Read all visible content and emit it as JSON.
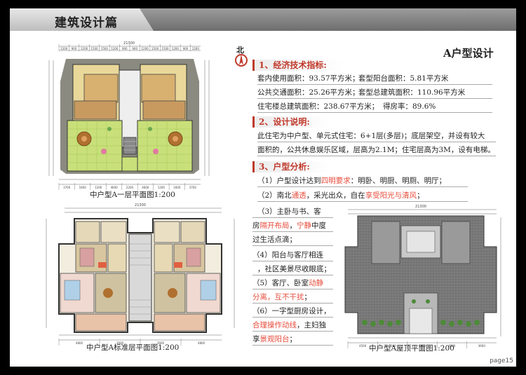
{
  "header": {
    "title": "建筑设计篇"
  },
  "right_title": "A户型设计",
  "compass_label": "北",
  "sections": [
    {
      "title": "1、经济技术指标:"
    },
    {
      "title": "2、设计说明:"
    },
    {
      "title": "3、户型分析:"
    }
  ],
  "tech": {
    "line1a": "套内使用面积：93.57平方米；",
    "line1b": "套型阳台面积：5.81平方米",
    "line2a": "公共交通面积：25.26平方米；",
    "line2b": "套型总建筑面积：110.96平方米",
    "line3a": "住宅楼总建筑面积：238.67平方米；",
    "line3b": "得房率：89.6%"
  },
  "design": {
    "line1": "此住宅为中户型、单元式住宅：6+1层(多层)；底层架空，并设有较大",
    "line2": "面积的，公共休息娱乐区域，层高为2.1M；住宅层高为3M，设有电梯。"
  },
  "analysis": {
    "p1_pre": "（1）户型设计达到",
    "p1_red": "四明要求",
    "p1_post": "：明卧、明厨、明厕、明厅；",
    "p2_pre": "（2）南北",
    "p2_red1": "通透",
    "p2_mid": "，采光出众，自在",
    "p2_red2": "享受阳光与清风",
    "p2_post": "；",
    "p3_a": "（3）主卧与书、客",
    "p3_b_pre": "房",
    "p3_b_red1": "隔开布局",
    "p3_b_mid": "，",
    "p3_b_red2": "宁静",
    "p3_b_post": "中度",
    "p3_c": "过生活点滴；",
    "p4_a": "（4）阳台与客厅相连",
    "p4_b": "，社区美景尽收眼底；",
    "p5_a_pre": "（5）客厅、卧室",
    "p5_a_red": "动静",
    "p5_b_red": "分离，互不干扰",
    "p5_b_post": "；",
    "p6_a": "（6）一字型厨房设计，",
    "p6_b_red": "合理操作动线",
    "p6_b_post": "，主妇独",
    "p6_c_pre": "享",
    "p6_c_red": "景观阳台",
    "p6_c_post": "；"
  },
  "plans": {
    "ground_caption": "中户型A一层平面图1:200",
    "standard_caption": "中户型A标准层平面图1:200",
    "roof_caption": "中户型A屋顶平面图1:200",
    "ground_dims_top": [
      "1200",
      "900",
      "1200",
      "1500",
      "1500",
      "1200",
      "900",
      "900",
      "1200",
      "1500",
      "1500",
      "1200",
      "900",
      "1200"
    ],
    "ground_total": "21300",
    "ground_dims_bottom": [
      "3700",
      "1600",
      "1200",
      "4600",
      "2200",
      "4600",
      "1200",
      "1600",
      "3700"
    ],
    "standard_total": "21300",
    "roof_total": "21300",
    "roof_dims_bottom": [
      "4500",
      "3600",
      "4800",
      "4800",
      "3600"
    ],
    "standard_dims_bottom": [
      "4800",
      "3600",
      "3600",
      "4800"
    ]
  },
  "page_number": "page15",
  "colors": {
    "accent": "#c0392b",
    "red_text": "#e74c3c"
  }
}
